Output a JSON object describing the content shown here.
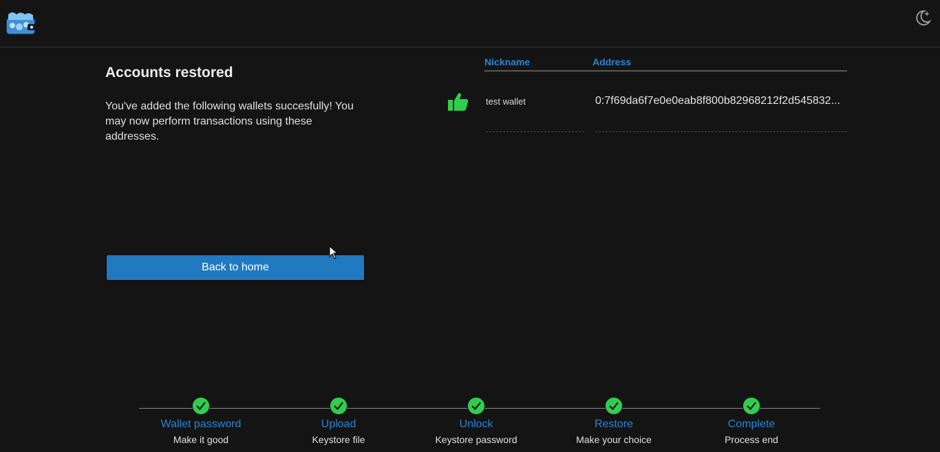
{
  "header": {
    "logo_icon": "wallet-logo-icon",
    "theme_icon": "moon-star-icon"
  },
  "main": {
    "title": "Accounts restored",
    "description": "You've added the following wallets succesfully! You may now perform transactions using these addresses.",
    "back_button_label": "Back to home",
    "status_icon": "thumbs-up-icon",
    "status_color": "#2fcf4d"
  },
  "table": {
    "columns": [
      "Nickname",
      "Address"
    ],
    "rows": [
      {
        "nickname": "test wallet",
        "address": "0:7f69da6f7e0e0eab8f800b82968212f2d545832..."
      }
    ]
  },
  "stepper": {
    "steps": [
      {
        "label": "Wallet password",
        "sub": "Make it good",
        "status": "complete"
      },
      {
        "label": "Upload",
        "sub": "Keystore file",
        "status": "complete"
      },
      {
        "label": "Unlock",
        "sub": "Keystore password",
        "status": "complete"
      },
      {
        "label": "Restore",
        "sub": "Make your choice",
        "status": "complete"
      },
      {
        "label": "Complete",
        "sub": "Process end",
        "status": "complete"
      }
    ]
  },
  "colors": {
    "accent": "#2179bf",
    "link": "#2c84d2",
    "background": "#141414",
    "success": "#2fcf4d"
  }
}
